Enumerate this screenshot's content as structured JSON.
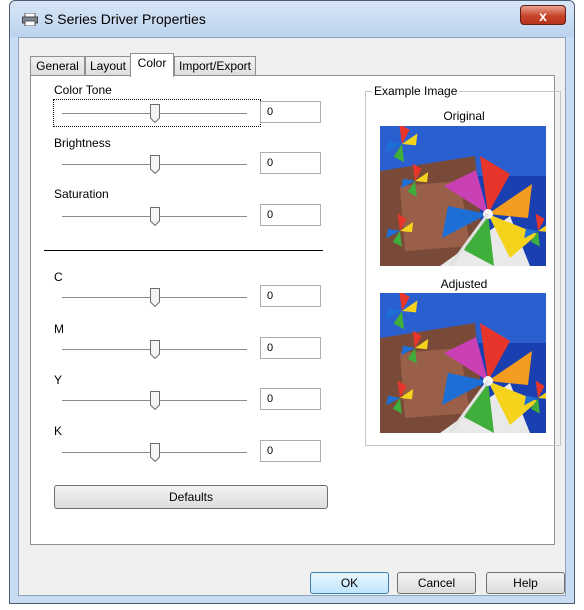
{
  "window": {
    "title": "S Series Driver Properties",
    "close_symbol": "x"
  },
  "tabs": [
    {
      "label": "General",
      "active": false
    },
    {
      "label": "Layout",
      "active": false
    },
    {
      "label": "Color",
      "active": true
    },
    {
      "label": "Import/Export",
      "active": false
    }
  ],
  "adjustments": {
    "color_tone": {
      "label": "Color Tone",
      "value": "0"
    },
    "brightness": {
      "label": "Brightness",
      "value": "0"
    },
    "saturation": {
      "label": "Saturation",
      "value": "0"
    }
  },
  "cmyk": {
    "c": {
      "label": "C",
      "value": "0"
    },
    "m": {
      "label": "M",
      "value": "0"
    },
    "y": {
      "label": "Y",
      "value": "0"
    },
    "k": {
      "label": "K",
      "value": "0"
    }
  },
  "defaults_label": "Defaults",
  "example": {
    "title": "Example Image",
    "original_label": "Original",
    "adjusted_label": "Adjusted"
  },
  "footer": {
    "ok": "OK",
    "cancel": "Cancel",
    "help": "Help"
  },
  "colors": {
    "pinwheel_red": "#e8352b",
    "pinwheel_yellow": "#f5d31d",
    "pinwheel_green": "#3fae3a",
    "pinwheel_blue": "#1d6fd6",
    "sky_blue": "#1a3fb0"
  }
}
